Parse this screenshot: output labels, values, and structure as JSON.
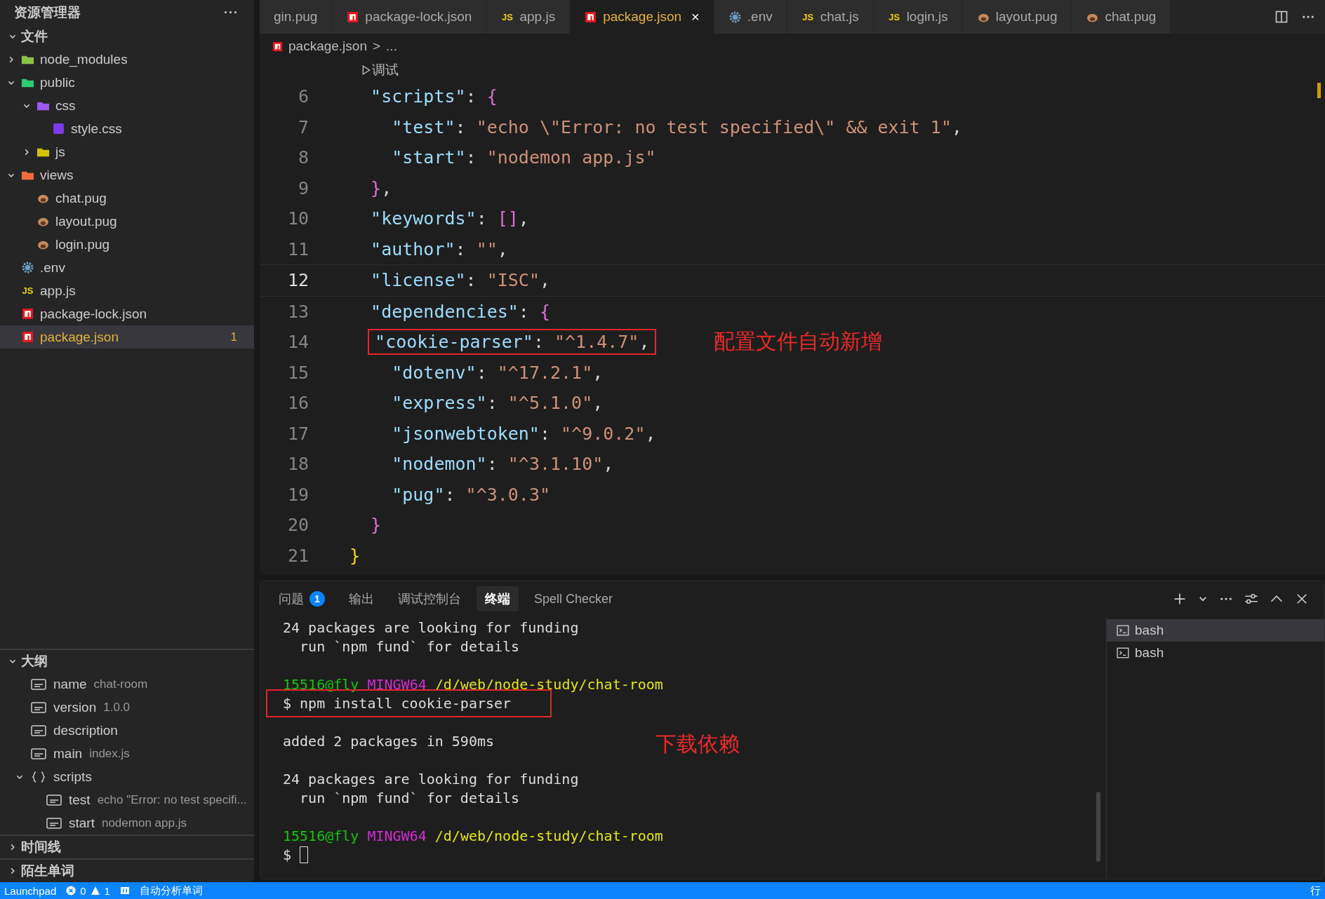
{
  "sidebar": {
    "title": "资源管理器",
    "more": "···",
    "section": {
      "label": "文件",
      "expanded": true
    },
    "files": [
      {
        "label": "node_modules",
        "kind": "node-folder",
        "expanded": false,
        "selected": false
      },
      {
        "label": "public",
        "kind": "public-folder",
        "expanded": true,
        "selected": false,
        "children": [
          {
            "label": "css",
            "kind": "css-folder",
            "expanded": true,
            "selected": false,
            "children": [
              {
                "label": "style.css",
                "kind": "css-file",
                "selected": false
              }
            ]
          },
          {
            "label": "js",
            "kind": "js-folder",
            "expanded": false,
            "selected": false
          }
        ]
      },
      {
        "label": "views",
        "kind": "views-folder",
        "expanded": true,
        "selected": false,
        "children": [
          {
            "label": "chat.pug",
            "kind": "pug-file",
            "selected": false
          },
          {
            "label": "layout.pug",
            "kind": "pug-file",
            "selected": false
          },
          {
            "label": "login.pug",
            "kind": "pug-file",
            "selected": false
          }
        ]
      },
      {
        "label": ".env",
        "kind": "config-file",
        "selected": false
      },
      {
        "label": "app.js",
        "kind": "js-file",
        "icon_text": "JS",
        "selected": false
      },
      {
        "label": "package-lock.json",
        "kind": "npm-file",
        "selected": false
      },
      {
        "label": "package.json",
        "kind": "npm-file",
        "selected": true,
        "warning": true,
        "badge": "1"
      }
    ],
    "outline": {
      "label": "大纲",
      "expanded": true,
      "items": [
        {
          "name": "name",
          "detail": "chat-room",
          "kind": "string"
        },
        {
          "name": "version",
          "detail": "1.0.0",
          "kind": "string"
        },
        {
          "name": "description",
          "kind": "string"
        },
        {
          "name": "main",
          "detail": "index.js",
          "kind": "string"
        },
        {
          "name": "scripts",
          "kind": "object",
          "expanded": true,
          "children": [
            {
              "name": "test",
              "detail": "echo \"Error: no test specifi...",
              "kind": "string"
            },
            {
              "name": "start",
              "detail": "nodemon app.js",
              "kind": "string"
            }
          ]
        }
      ]
    },
    "sections": [
      {
        "label": "时间线",
        "expanded": false
      },
      {
        "label": "陌生单词",
        "expanded": false
      }
    ]
  },
  "tabs": [
    {
      "label": "gin.pug",
      "selected": false
    },
    {
      "label": "package-lock.json",
      "kind": "npm-file",
      "selected": false
    },
    {
      "label": "app.js",
      "kind": "js-file",
      "icon_text": "JS",
      "selected": false
    },
    {
      "label": "package.json",
      "kind": "npm-file",
      "selected": true,
      "warning": true,
      "close": "×"
    },
    {
      "label": ".env",
      "kind": "config-file",
      "selected": false
    },
    {
      "label": "chat.js",
      "kind": "js-file",
      "icon_text": "JS",
      "selected": false
    },
    {
      "label": "login.js",
      "kind": "js-file",
      "icon_text": "JS",
      "selected": false
    },
    {
      "label": "layout.pug",
      "kind": "pug-file",
      "selected": false
    },
    {
      "label": "chat.pug",
      "kind": "pug-file",
      "selected": false
    }
  ],
  "breadcrumb": {
    "file": "package.json",
    "separator": ">",
    "rest": "..."
  },
  "codelens": "调试",
  "code": [
    {
      "number": "6",
      "current": false,
      "boxed": false,
      "tokens": [
        {
          "kind": "key",
          "text": "  \"scripts\""
        },
        {
          "kind": "punct",
          "text": ": "
        },
        {
          "kind": "bracket",
          "text": "{"
        }
      ]
    },
    {
      "number": "7",
      "current": false,
      "boxed": false,
      "tokens": [
        {
          "kind": "key",
          "text": "    \"test\""
        },
        {
          "kind": "punct",
          "text": ": "
        },
        {
          "kind": "string",
          "text": "\"echo \\\"Error: no test specified\\\" && exit 1\""
        },
        {
          "kind": "punct",
          "text": ","
        }
      ]
    },
    {
      "number": "8",
      "current": false,
      "boxed": false,
      "tokens": [
        {
          "kind": "key",
          "text": "    \"start\""
        },
        {
          "kind": "punct",
          "text": ": "
        },
        {
          "kind": "string",
          "text": "\"nodemon app.js\""
        }
      ]
    },
    {
      "number": "9",
      "current": false,
      "boxed": false,
      "tokens": [
        {
          "kind": "bracket",
          "text": "  }"
        },
        {
          "kind": "punct",
          "text": ","
        }
      ]
    },
    {
      "number": "10",
      "current": false,
      "boxed": false,
      "tokens": [
        {
          "kind": "key",
          "text": "  \"keywords\""
        },
        {
          "kind": "punct",
          "text": ": "
        },
        {
          "kind": "bracket",
          "text": "[]"
        },
        {
          "kind": "punct",
          "text": ","
        }
      ]
    },
    {
      "number": "11",
      "current": false,
      "boxed": false,
      "tokens": [
        {
          "kind": "key",
          "text": "  \"author\""
        },
        {
          "kind": "punct",
          "text": ": "
        },
        {
          "kind": "string",
          "text": "\"\""
        },
        {
          "kind": "punct",
          "text": ","
        }
      ]
    },
    {
      "number": "12",
      "current": true,
      "boxed": false,
      "tokens": [
        {
          "kind": "key",
          "text": "  \"license\""
        },
        {
          "kind": "punct",
          "text": ": "
        },
        {
          "kind": "string",
          "text": "\"ISC\""
        },
        {
          "kind": "punct",
          "text": ","
        }
      ]
    },
    {
      "number": "13",
      "current": false,
      "boxed": false,
      "tokens": [
        {
          "kind": "key",
          "text": "  \"dependencies\""
        },
        {
          "kind": "punct",
          "text": ": "
        },
        {
          "kind": "bracket",
          "text": "{"
        }
      ]
    },
    {
      "number": "14",
      "current": false,
      "boxed": true,
      "note": "配置文件自动新增",
      "tokens": [
        {
          "kind": "key",
          "text": "\"cookie-parser\""
        },
        {
          "kind": "punct",
          "text": ": "
        },
        {
          "kind": "string",
          "text": "\"^1.4.7\""
        },
        {
          "kind": "punct",
          "text": ","
        }
      ]
    },
    {
      "number": "15",
      "current": false,
      "boxed": false,
      "tokens": [
        {
          "kind": "key",
          "text": "    \"dotenv\""
        },
        {
          "kind": "punct",
          "text": ": "
        },
        {
          "kind": "string",
          "text": "\"^17.2.1\""
        },
        {
          "kind": "punct",
          "text": ","
        }
      ]
    },
    {
      "number": "16",
      "current": false,
      "boxed": false,
      "tokens": [
        {
          "kind": "key",
          "text": "    \"express\""
        },
        {
          "kind": "punct",
          "text": ": "
        },
        {
          "kind": "string",
          "text": "\"^5.1.0\""
        },
        {
          "kind": "punct",
          "text": ","
        }
      ]
    },
    {
      "number": "17",
      "current": false,
      "boxed": false,
      "tokens": [
        {
          "kind": "key",
          "text": "    \"jsonwebtoken\""
        },
        {
          "kind": "punct",
          "text": ": "
        },
        {
          "kind": "string",
          "text": "\"^9.0.2\""
        },
        {
          "kind": "punct",
          "text": ","
        }
      ]
    },
    {
      "number": "18",
      "current": false,
      "boxed": false,
      "tokens": [
        {
          "kind": "key",
          "text": "    \"nodemon\""
        },
        {
          "kind": "punct",
          "text": ": "
        },
        {
          "kind": "string",
          "text": "\"^3.1.10\""
        },
        {
          "kind": "punct",
          "text": ","
        }
      ]
    },
    {
      "number": "19",
      "current": false,
      "boxed": false,
      "tokens": [
        {
          "kind": "key",
          "text": "    \"pug\""
        },
        {
          "kind": "punct",
          "text": ": "
        },
        {
          "kind": "string",
          "text": "\"^3.0.3\""
        }
      ]
    },
    {
      "number": "20",
      "current": false,
      "boxed": false,
      "tokens": [
        {
          "kind": "bracket",
          "text": "  }"
        }
      ]
    },
    {
      "number": "21",
      "current": false,
      "boxed": false,
      "tokens": [
        {
          "kind": "outer",
          "text": "}"
        }
      ]
    }
  ],
  "panel": {
    "tabs": [
      {
        "label": "问题",
        "badge": "1",
        "selected": false
      },
      {
        "label": "输出",
        "selected": false
      },
      {
        "label": "调试控制台",
        "selected": false
      },
      {
        "label": "终端",
        "selected": true
      },
      {
        "label": "Spell Checker",
        "selected": false
      }
    ],
    "terminal": [
      {
        "kind": "text",
        "text": "24 packages are looking for funding",
        "boxed": false
      },
      {
        "kind": "text",
        "text": "  run `npm fund` for details",
        "boxed": false
      },
      {
        "kind": "blank"
      },
      {
        "kind": "prompt",
        "user": "15516@fly",
        "system": "MINGW64",
        "path": "/d/web/node-study/chat-room"
      },
      {
        "kind": "text",
        "text": "$ npm install cookie-parser",
        "boxed": true
      },
      {
        "kind": "blank"
      },
      {
        "kind": "text",
        "text": "added 2 packages in 590ms",
        "boxed": false,
        "note": "下载依赖"
      },
      {
        "kind": "blank"
      },
      {
        "kind": "text",
        "text": "24 packages are looking for funding",
        "boxed": false
      },
      {
        "kind": "text",
        "text": "  run `npm fund` for details",
        "boxed": false
      },
      {
        "kind": "blank"
      },
      {
        "kind": "prompt",
        "user": "15516@fly",
        "system": "MINGW64",
        "path": "/d/web/node-study/chat-room"
      },
      {
        "kind": "input",
        "text": "$ "
      }
    ],
    "sessions": [
      {
        "label": "bash",
        "selected": true
      },
      {
        "label": "bash",
        "selected": false
      }
    ]
  },
  "status_bar": {
    "left": "Launchpad",
    "errors": "0",
    "warnings": "1",
    "analysis": "自动分析单词",
    "right": "行"
  }
}
